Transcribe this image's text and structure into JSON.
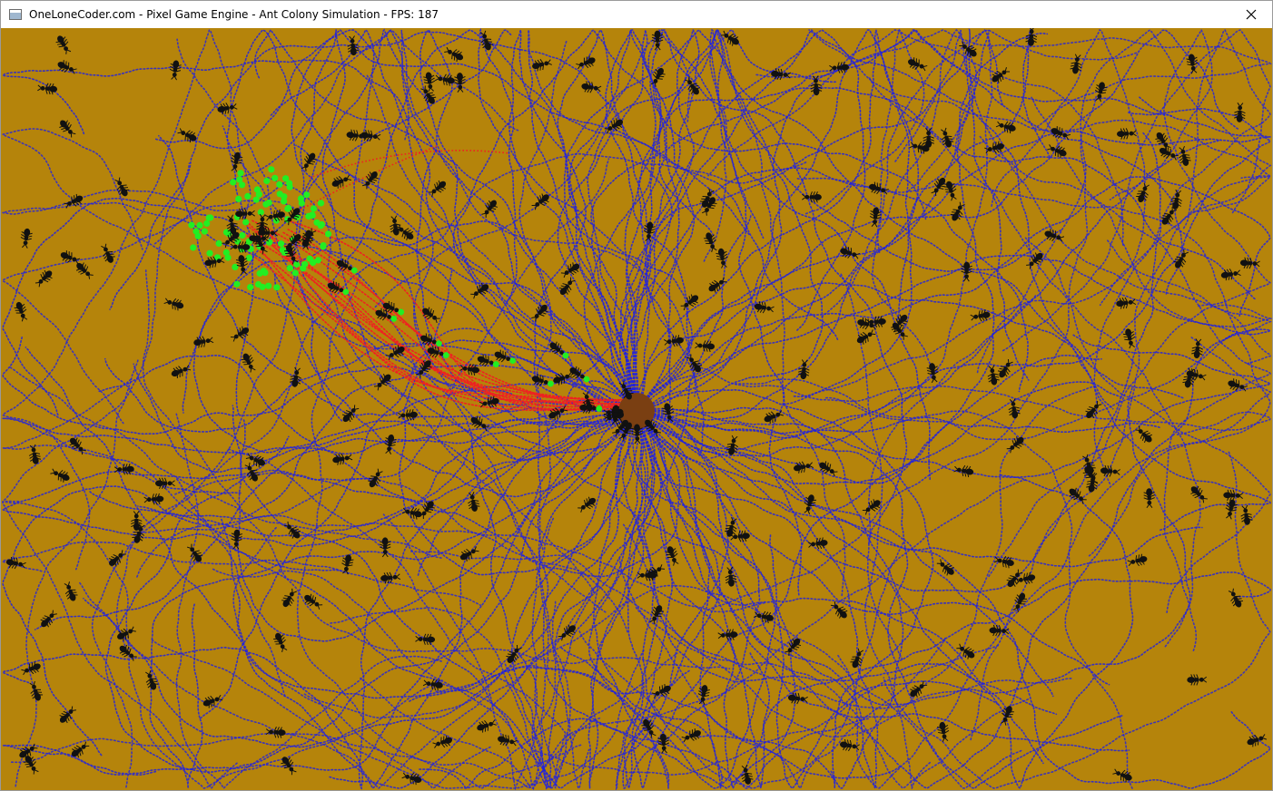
{
  "window": {
    "title": "OneLoneCoder.com - Pixel Game Engine - Ant Colony Simulation - FPS: 187",
    "close_icon": "close-icon",
    "app_icon": "window-app-icon"
  },
  "scene": {
    "background_color": "#b5840b",
    "nest_color": "#7a3f12",
    "ant_color": "#111111",
    "home_trail_color": "#2222dd",
    "food_trail_color": "#ee2222",
    "food_color": "#22ee22",
    "ant_count": 240,
    "food_pellet_count": 90,
    "food_carriers": 12
  }
}
